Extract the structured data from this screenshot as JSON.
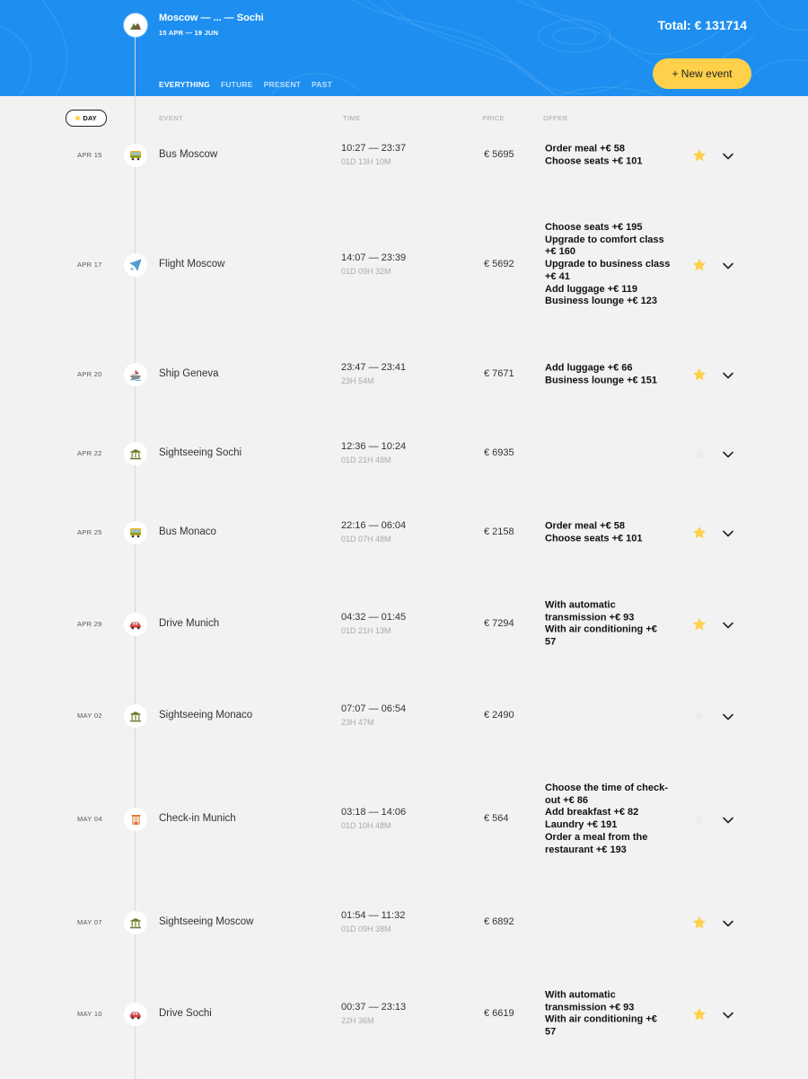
{
  "header": {
    "route": "Moscow — ... — Sochi",
    "dates": "15 APR — 19 JUN",
    "total": "Total: € 131714",
    "trip_icon": "mountain-icon",
    "filters": [
      {
        "label": "EVERYTHING",
        "active": true
      },
      {
        "label": "FUTURE",
        "active": false
      },
      {
        "label": "PRESENT",
        "active": false
      },
      {
        "label": "PAST",
        "active": false
      }
    ],
    "new_event_label": "+ New event",
    "colors": {
      "header_bg": "#1e8ff0",
      "accent": "#ffd04a"
    }
  },
  "sort": {
    "day_label": "DAY",
    "columns": {
      "event": "EVENT",
      "time": "TIME",
      "price": "PRICE",
      "offer": "OFFER"
    }
  },
  "events": [
    {
      "date": "APR 15",
      "icon": "bus-icon",
      "title": "Bus Moscow",
      "time": "10:27 — 23:37",
      "duration": "01D 13H 10M",
      "price": "€ 5695",
      "offers": [
        "Order meal +€  58",
        "Choose seats +€  101"
      ],
      "favorite": true
    },
    {
      "date": "APR 17",
      "icon": "plane-icon",
      "title": "Flight Moscow",
      "time": "14:07 — 23:39",
      "duration": "01D 09H 32M",
      "price": "€ 5692",
      "offers": [
        "Choose seats +€  195",
        "Upgrade to comfort class +€  160",
        "Upgrade to business class +€  41",
        "Add luggage +€  119",
        "Business lounge +€  123"
      ],
      "favorite": true
    },
    {
      "date": "APR 20",
      "icon": "ship-icon",
      "title": "Ship Geneva",
      "time": "23:47 — 23:41",
      "duration": "23H 54M",
      "price": "€ 7671",
      "offers": [
        "Add luggage +€  66",
        "Business lounge +€  151"
      ],
      "favorite": true
    },
    {
      "date": "APR 22",
      "icon": "landmark-icon",
      "title": "Sightseeing Sochi",
      "time": "12:36 — 10:24",
      "duration": "01D 21H 48M",
      "price": "€ 6935",
      "offers": [],
      "favorite": false
    },
    {
      "date": "APR 25",
      "icon": "bus-icon",
      "title": "Bus Monaco",
      "time": "22:16 — 06:04",
      "duration": "01D 07H 48M",
      "price": "€ 2158",
      "offers": [
        "Order meal +€  58",
        "Choose seats +€  101"
      ],
      "favorite": true
    },
    {
      "date": "APR 29",
      "icon": "car-icon",
      "title": "Drive Munich",
      "time": "04:32 — 01:45",
      "duration": "01D 21H 13M",
      "price": "€ 7294",
      "offers": [
        "With automatic transmission +€  93",
        "With air conditioning +€  57"
      ],
      "favorite": true
    },
    {
      "date": "MAY 02",
      "icon": "landmark-icon",
      "title": "Sightseeing Monaco",
      "time": "07:07 — 06:54",
      "duration": "23H 47M",
      "price": "€ 2490",
      "offers": [],
      "favorite": false
    },
    {
      "date": "MAY 04",
      "icon": "hotel-icon",
      "title": "Check-in Munich",
      "time": "03:18 — 14:06",
      "duration": "01D 10H 48M",
      "price": "€ 564",
      "offers": [
        "Choose the time of check-out +€  86",
        "Add breakfast +€  82",
        "Laundry +€  191",
        "Order a meal from the restaurant +€  193"
      ],
      "favorite": false
    },
    {
      "date": "MAY 07",
      "icon": "landmark-icon",
      "title": "Sightseeing Moscow",
      "time": "01:54 — 11:32",
      "duration": "01D 09H 38M",
      "price": "€ 6892",
      "offers": [],
      "favorite": true
    },
    {
      "date": "MAY 10",
      "icon": "car-icon",
      "title": "Drive Sochi",
      "time": "00:37 — 23:13",
      "duration": "22H 36M",
      "price": "€ 6619",
      "offers": [
        "With automatic transmission +€  93",
        "With air conditioning +€  57"
      ],
      "favorite": true
    }
  ]
}
